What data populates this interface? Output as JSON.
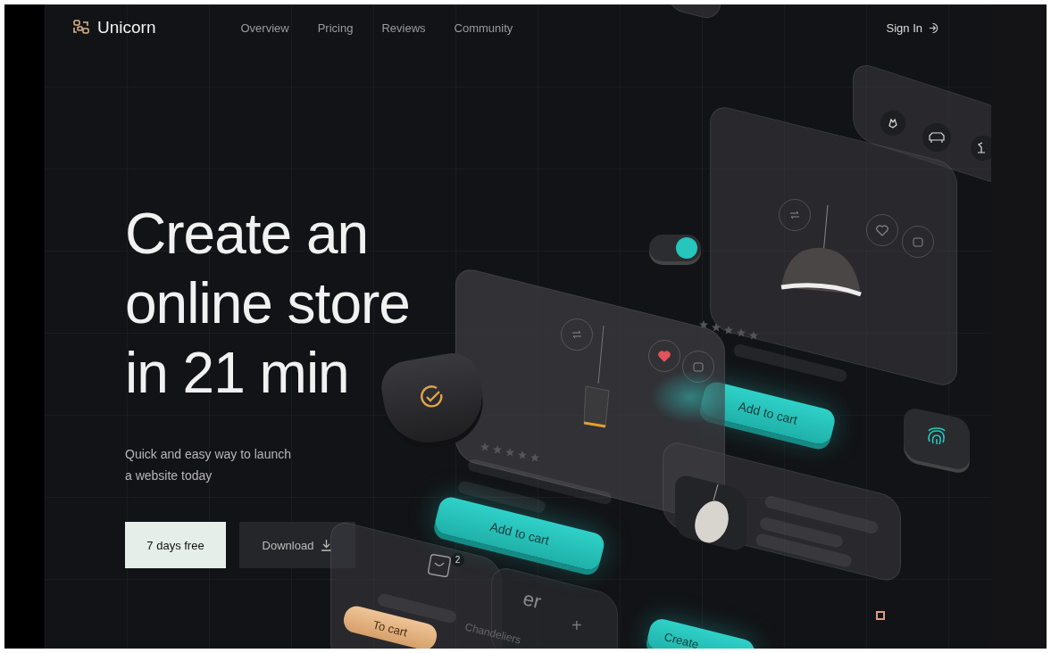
{
  "brand": {
    "name": "Unicorn"
  },
  "nav": [
    {
      "label": "Overview"
    },
    {
      "label": "Pricing"
    },
    {
      "label": "Reviews"
    },
    {
      "label": "Community"
    }
  ],
  "sign_in": {
    "label": "Sign In"
  },
  "hero": {
    "title_lines": [
      "Create an",
      "online store",
      "in 21 min"
    ],
    "subtitle_lines": [
      "Quick and easy way to launch",
      "a website today"
    ],
    "primary_button": "7 days free",
    "secondary_button": "Download"
  },
  "illustration": {
    "toggle": {
      "on": true
    },
    "product_cards": [
      {
        "liked": false,
        "button": "Add to cart"
      },
      {
        "liked": true,
        "button": "Add to cart"
      }
    ],
    "cart": {
      "badge": "2",
      "button": "To cart"
    },
    "category_card": {
      "title": "er",
      "item": "Chandeliers",
      "add": "+"
    },
    "create_button": "Create"
  }
}
